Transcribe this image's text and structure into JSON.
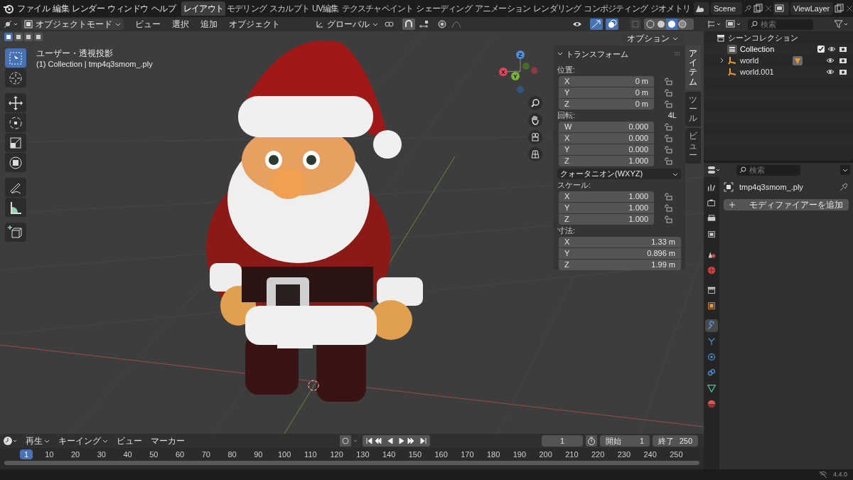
{
  "menu": [
    "ファイル",
    "編集",
    "レンダー",
    "ウィンドウ",
    "ヘルプ"
  ],
  "workspaces": [
    {
      "label": "レイアウト",
      "selected": true
    },
    {
      "label": "モデリング",
      "selected": false
    },
    {
      "label": "スカルプト",
      "selected": false
    },
    {
      "label": "UV編集",
      "selected": false
    },
    {
      "label": "テクスチャペイント",
      "selected": false
    },
    {
      "label": "シェーディング",
      "selected": false
    },
    {
      "label": "アニメーション",
      "selected": false
    },
    {
      "label": "レンダリング",
      "selected": false
    },
    {
      "label": "コンポジティング",
      "selected": false
    },
    {
      "label": "ジオメトリ",
      "selected": false
    }
  ],
  "scene": "Scene",
  "view_layer": "ViewLayer",
  "viewport_header": {
    "mode": "オブジェクトモード",
    "menus": [
      "ビュー",
      "選択",
      "追加",
      "オブジェクト"
    ],
    "orientation": "グローバル",
    "options": "オプション"
  },
  "tools": [
    {
      "kind": "select",
      "selected": true
    },
    {
      "kind": "cursor",
      "selected": false
    },
    {
      "kind": "move",
      "selected": false
    },
    {
      "kind": "rotate",
      "selected": false
    },
    {
      "kind": "scale",
      "selected": false
    },
    {
      "kind": "transform",
      "selected": false
    },
    {
      "kind": "annotate",
      "selected": false
    },
    {
      "kind": "measure",
      "selected": false
    },
    {
      "kind": "add_cube",
      "selected": false
    }
  ],
  "viewport_overlay": {
    "view": "ユーザー・透視投影",
    "object": "(1) Collection | tmp4q3smom_.ply"
  },
  "gizmo_axes": [
    "X",
    "Y",
    "Z"
  ],
  "n_panel": {
    "title": "トランスフォーム",
    "sections": [
      {
        "label": "位置:",
        "locks": true,
        "fields": [
          {
            "axis": "X",
            "value": "0 m"
          },
          {
            "axis": "Y",
            "value": "0 m"
          },
          {
            "axis": "Z",
            "value": "0 m"
          }
        ]
      },
      {
        "label": "回転:",
        "note": "4L",
        "locks": true,
        "fields": [
          {
            "axis": "W",
            "value": "0.000"
          },
          {
            "axis": "X",
            "value": "0.000"
          },
          {
            "axis": "Y",
            "value": "0.000"
          },
          {
            "axis": "Z",
            "value": "1.000"
          }
        ],
        "mode": "クォータニオン(WXYZ)"
      },
      {
        "label": "スケール:",
        "locks": true,
        "fields": [
          {
            "axis": "X",
            "value": "1.000"
          },
          {
            "axis": "Y",
            "value": "1.000"
          },
          {
            "axis": "Z",
            "value": "1.000"
          }
        ]
      },
      {
        "label": "寸法:",
        "locks": false,
        "fields": [
          {
            "axis": "X",
            "value": "1.33 m"
          },
          {
            "axis": "Y",
            "value": "0.896 m"
          },
          {
            "axis": "Z",
            "value": "1.99 m"
          }
        ]
      }
    ],
    "tabs": [
      {
        "label": "アイテム",
        "selected": true
      },
      {
        "label": "ツール",
        "selected": false
      },
      {
        "label": "ビュー",
        "selected": false
      }
    ]
  },
  "outliner": {
    "search_placeholder": "検索",
    "root": "シーンコレクション",
    "collection": {
      "name": "Collection",
      "checked": true
    },
    "items": [
      {
        "name": "world",
        "expanded": false,
        "has_data": true
      },
      {
        "name": "world.001",
        "has_data": false
      }
    ]
  },
  "properties": {
    "search_placeholder": "検索",
    "object": "tmp4q3smom_.ply",
    "add_modifier": "モディファイアーを追加",
    "tabs": [
      {
        "kind": "tool",
        "selected": false
      },
      {
        "kind": "render",
        "selected": false
      },
      {
        "kind": "output",
        "selected": false
      },
      {
        "kind": "view_layer",
        "selected": false
      },
      {
        "kind": "scene",
        "selected": false
      },
      {
        "kind": "world",
        "selected": false
      },
      {
        "kind": "collection",
        "selected": false
      },
      {
        "kind": "object",
        "selected": false
      },
      {
        "kind": "modifier",
        "selected": true
      },
      {
        "kind": "particles",
        "selected": false
      },
      {
        "kind": "physics",
        "selected": false
      },
      {
        "kind": "constraints",
        "selected": false
      },
      {
        "kind": "data",
        "selected": false
      },
      {
        "kind": "material",
        "selected": false
      }
    ]
  },
  "timeline": {
    "menus": [
      "再生",
      "キーイング",
      "ビュー",
      "マーカー"
    ],
    "frame": "1",
    "start_label": "開始",
    "start": "1",
    "end_label": "終了",
    "end": "250",
    "current": "1",
    "ticks": [
      "10",
      "20",
      "30",
      "40",
      "50",
      "60",
      "70",
      "80",
      "90",
      "100",
      "110",
      "120",
      "130",
      "140",
      "150",
      "160",
      "170",
      "180",
      "190",
      "200",
      "210",
      "220",
      "230",
      "240",
      "250"
    ]
  },
  "version": "4.4.0"
}
